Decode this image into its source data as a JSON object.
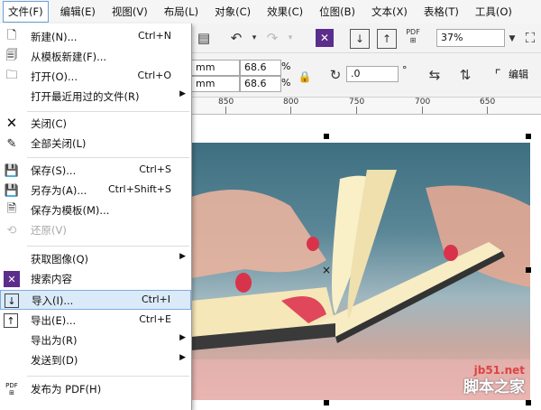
{
  "menubar": {
    "items": [
      {
        "label": "文件(F)",
        "active": true
      },
      {
        "label": "编辑(E)"
      },
      {
        "label": "视图(V)"
      },
      {
        "label": "布局(L)"
      },
      {
        "label": "对象(C)"
      },
      {
        "label": "效果(C)"
      },
      {
        "label": "位图(B)"
      },
      {
        "label": "文本(X)"
      },
      {
        "label": "表格(T)"
      },
      {
        "label": "工具(O)"
      }
    ]
  },
  "file_menu": {
    "items": [
      {
        "label": "新建(N)...",
        "shortcut": "Ctrl+N",
        "icon": "new-doc-icon"
      },
      {
        "label": "从模板新建(F)...",
        "shortcut": "",
        "icon": "template-icon"
      },
      {
        "label": "打开(O)...",
        "shortcut": "Ctrl+O",
        "icon": "folder-icon"
      },
      {
        "label": "打开最近用过的文件(R)",
        "shortcut": "",
        "submenu": true
      },
      {
        "label": "关闭(C)",
        "shortcut": "",
        "icon": "close-doc-icon"
      },
      {
        "label": "全部关闭(L)",
        "shortcut": "",
        "icon": "close-all-icon"
      },
      {
        "label": "保存(S)...",
        "shortcut": "Ctrl+S",
        "icon": "save-icon"
      },
      {
        "label": "另存为(A)...",
        "shortcut": "Ctrl+Shift+S",
        "icon": "save-as-icon"
      },
      {
        "label": "保存为模板(M)...",
        "shortcut": "",
        "icon": "save-template-icon"
      },
      {
        "label": "还原(V)",
        "shortcut": "",
        "disabled": true,
        "icon": "revert-icon"
      },
      {
        "label": "获取图像(Q)",
        "shortcut": "",
        "submenu": true
      },
      {
        "label": "搜索内容",
        "shortcut": "",
        "icon": "search-content-icon"
      },
      {
        "label": "导入(I)...",
        "shortcut": "Ctrl+I",
        "highlighted": true,
        "icon": "import-icon"
      },
      {
        "label": "导出(E)...",
        "shortcut": "Ctrl+E",
        "icon": "export-icon"
      },
      {
        "label": "导出为(R)",
        "shortcut": "",
        "submenu": true
      },
      {
        "label": "发送到(D)",
        "shortcut": "",
        "submenu": true
      },
      {
        "label": "发布为 PDF(H)",
        "shortcut": "",
        "icon": "pdf-icon"
      }
    ],
    "icon_pdf_text": "PDF"
  },
  "toolbar": {
    "zoom_value": "37%",
    "pdf_label": "PDF",
    "x_unit": "mm",
    "y_unit": "mm",
    "width_value": "68.6",
    "height_value": "68.6",
    "percent_sign": "%",
    "rotation_value": ".0",
    "degree_sign": "°",
    "edit_label": "编辑"
  },
  "ruler": {
    "ticks": [
      "850",
      "800",
      "750",
      "700",
      "650"
    ]
  },
  "watermark": {
    "site": "jb51.net",
    "name": "脚本之家"
  }
}
